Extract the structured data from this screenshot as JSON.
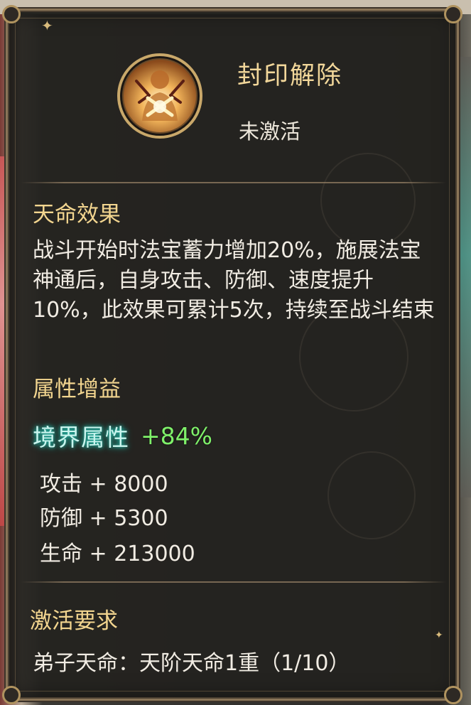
{
  "skill": {
    "title": "封印解除",
    "status": "未激活",
    "icon": "seal-release-emblem-icon"
  },
  "destiny_effect": {
    "heading": "天命效果",
    "description": "战斗开始时法宝蓄力增加20%，施展法宝神通后，自身攻击、防御、速度提升10%，此效果可累计5次，持续至战斗结束"
  },
  "attribute_bonus": {
    "heading": "属性增益",
    "realm_label": "境界属性",
    "realm_value": "+84%",
    "stats": [
      {
        "text": "攻击 + 8000"
      },
      {
        "text": "防御 + 5300"
      },
      {
        "text": "生命 + 213000"
      }
    ]
  },
  "activation": {
    "heading": "激活要求",
    "requirement": "弟子天命：天阶天命1重（1/10）"
  },
  "colors": {
    "panel_bg": "#24221f",
    "frame": "#8a7558",
    "heading": "#f2d58f",
    "body_text": "#f1ece3",
    "realm_glow": "#24c8b6",
    "bonus_green": "#7ff06a"
  }
}
